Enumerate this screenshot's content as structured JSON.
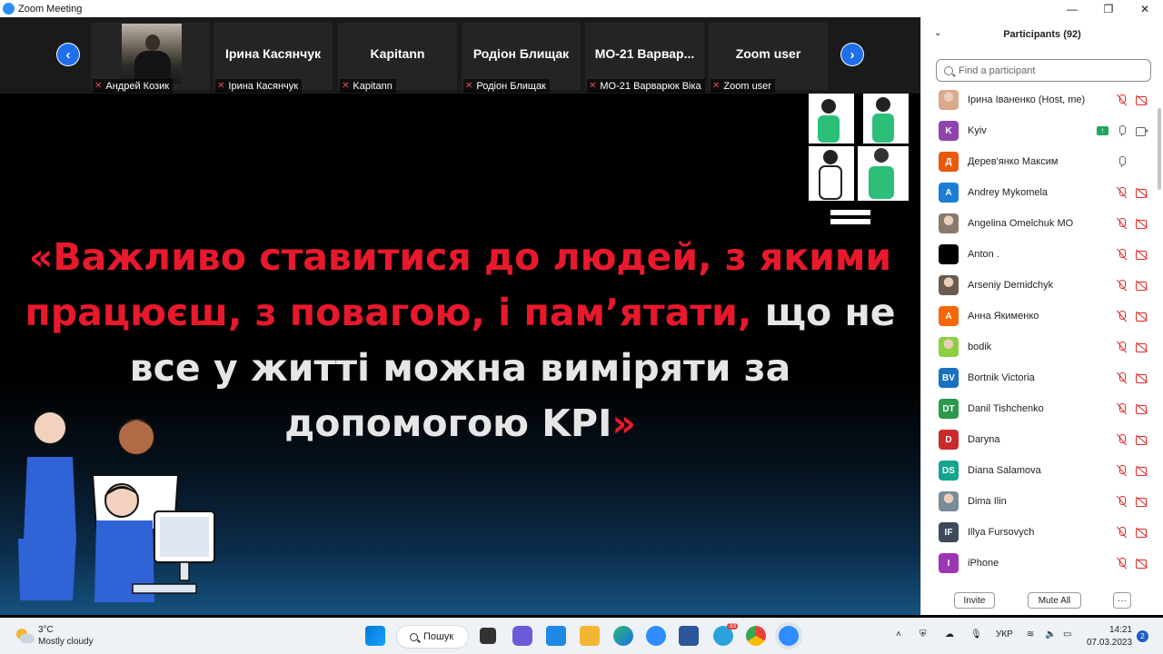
{
  "window": {
    "title": "Zoom Meeting",
    "minimize": "—",
    "maximize": "❐",
    "close": "✕"
  },
  "strip": {
    "prev": "‹",
    "next": "›",
    "tiles": [
      {
        "name": "",
        "label": "Андрей Козик"
      },
      {
        "name": "Ірина Касянчук",
        "label": "Ірина Касянчук"
      },
      {
        "name": "Kapitann",
        "label": "Kapitann"
      },
      {
        "name": "Родіон Блищак",
        "label": "Родіон Блищак"
      },
      {
        "name": "МО-21  Варвар...",
        "label": "МО-21 Варварюк Віка"
      },
      {
        "name": "Zoom user",
        "label": "Zoom user"
      }
    ]
  },
  "slide": {
    "part1": "«Важливо ставитися до людей, з якими працюєш, з повагою, і пам’ятати,",
    "part2": " що не все у житті можна виміряти за допомогою KPI",
    "part3": "»"
  },
  "participants": {
    "title": "Participants (92)",
    "search_placeholder": "Find a participant",
    "list": [
      {
        "name": "Ірина Іваненко (Host, me)",
        "initials": "",
        "color": "#d9a98a",
        "photo": true,
        "mic": "off",
        "cam": "off"
      },
      {
        "name": "Kyiv",
        "initials": "K",
        "color": "#8e44ad",
        "mic": "on",
        "cam": "on",
        "share": true
      },
      {
        "name": "Дерев'янко Максим",
        "initials": "Д",
        "color": "#e8590c",
        "mic": "on",
        "cam": "none"
      },
      {
        "name": "Andrey Mykomela",
        "initials": "A",
        "color": "#1c7ed6",
        "mic": "off",
        "cam": "off"
      },
      {
        "name": "Angelina Omelchuk МО",
        "initials": "",
        "color": "#8a7a6a",
        "photo": true,
        "mic": "off",
        "cam": "off"
      },
      {
        "name": "Anton .",
        "initials": "",
        "color": "#000000",
        "mic": "off",
        "cam": "off"
      },
      {
        "name": "Arseniy Demidchyk",
        "initials": "",
        "color": "#6b5b4f",
        "photo": true,
        "mic": "off",
        "cam": "off"
      },
      {
        "name": "Анна Якименко",
        "initials": "A",
        "color": "#f76707",
        "mic": "off",
        "cam": "off"
      },
      {
        "name": "bodik",
        "initials": "",
        "color": "#8ccf3f",
        "photo": true,
        "mic": "off",
        "cam": "off"
      },
      {
        "name": "Bortnik Victoria",
        "initials": "BV",
        "color": "#1971c2",
        "mic": "off",
        "cam": "off"
      },
      {
        "name": "Danil Tishchenko",
        "initials": "DT",
        "color": "#2b9a4b",
        "mic": "off",
        "cam": "off"
      },
      {
        "name": "Daryna",
        "initials": "D",
        "color": "#c92a2a",
        "mic": "off",
        "cam": "off"
      },
      {
        "name": "Diana Salamova",
        "initials": "DS",
        "color": "#12a58f",
        "mic": "off",
        "cam": "off"
      },
      {
        "name": "Dima Ilin",
        "initials": "",
        "color": "#7a8b9a",
        "photo": true,
        "mic": "off",
        "cam": "off"
      },
      {
        "name": "Illya Fursovych",
        "initials": "IF",
        "color": "#3d4a5c",
        "mic": "off",
        "cam": "off"
      },
      {
        "name": "iPhone",
        "initials": "I",
        "color": "#9c36b5",
        "mic": "off",
        "cam": "off"
      }
    ],
    "invite": "Invite",
    "mute_all": "Mute All",
    "more": "···"
  },
  "taskbar": {
    "temp": "3°C",
    "weather": "Mostly cloudy",
    "search": "Пошук",
    "lang": "УКР",
    "time": "14:21",
    "date": "07.03.2023",
    "notifications": "2",
    "telegram_badge": "33"
  }
}
